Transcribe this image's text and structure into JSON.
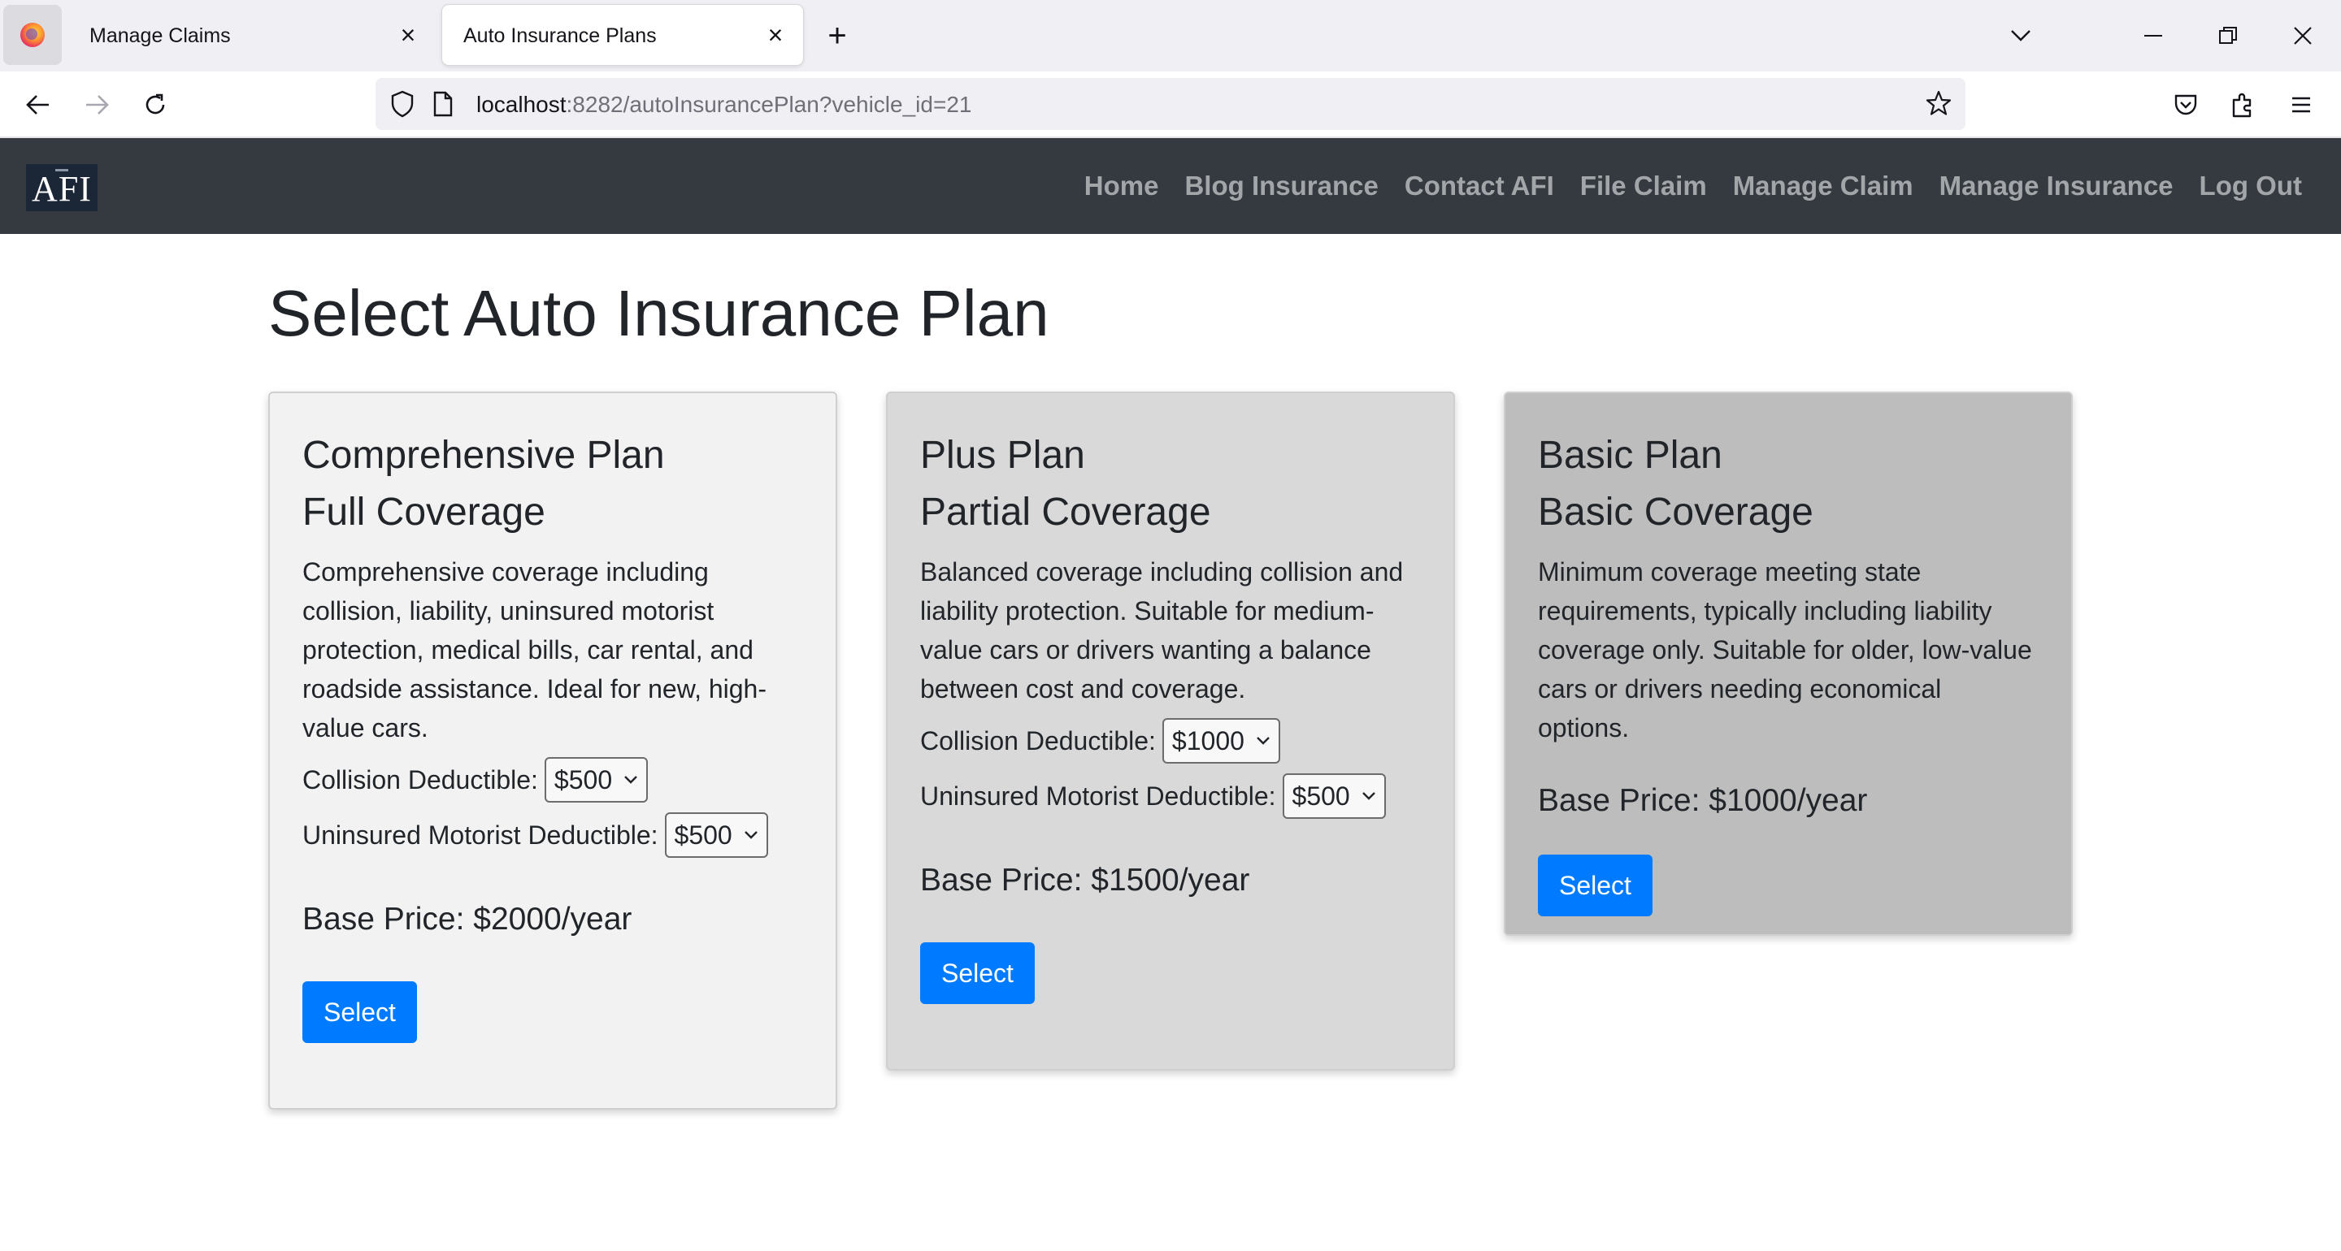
{
  "browser": {
    "tabs": [
      {
        "title": "Manage Claims",
        "active": false
      },
      {
        "title": "Auto Insurance Plans",
        "active": true
      }
    ],
    "url_host": "localhost",
    "url_rest": ":8282/autoInsurancePlan?vehicle_id=21"
  },
  "site": {
    "brand": "AFI",
    "nav": [
      "Home",
      "Blog Insurance",
      "Contact AFI",
      "File Claim",
      "Manage Claim",
      "Manage Insurance",
      "Log Out"
    ]
  },
  "page": {
    "title": "Select Auto Insurance Plan"
  },
  "plans": [
    {
      "name": "Comprehensive Plan",
      "coverage": "Full Coverage",
      "description": "Comprehensive coverage including collision, liability, uninsured motorist protection, medical bills, car rental, and roadside assistance. Ideal for new, high-value cars.",
      "collision_label": "Collision Deductible:",
      "collision_value": "$500",
      "uninsured_label": "Uninsured Motorist Deductible:",
      "uninsured_value": "$500",
      "price": "Base Price: $2000/year",
      "button": "Select",
      "background": "#f2f2f2"
    },
    {
      "name": "Plus Plan",
      "coverage": "Partial Coverage",
      "description": "Balanced coverage including collision and liability protection. Suitable for medium-value cars or drivers wanting a balance between cost and coverage.",
      "collision_label": "Collision Deductible:",
      "collision_value": "$1000",
      "uninsured_label": "Uninsured Motorist Deductible:",
      "uninsured_value": "$500",
      "price": "Base Price: $1500/year",
      "button": "Select",
      "background": "#d9d9d9"
    },
    {
      "name": "Basic Plan",
      "coverage": "Basic Coverage",
      "description": "Minimum coverage meeting state requirements, typically including liability coverage only. Suitable for older, low-value cars or drivers needing economical options.",
      "price": "Base Price: $1000/year",
      "button": "Select",
      "background": "#bdbdbd"
    }
  ],
  "colors": {
    "header_bg": "#343a40",
    "button_primary": "#007bff"
  }
}
